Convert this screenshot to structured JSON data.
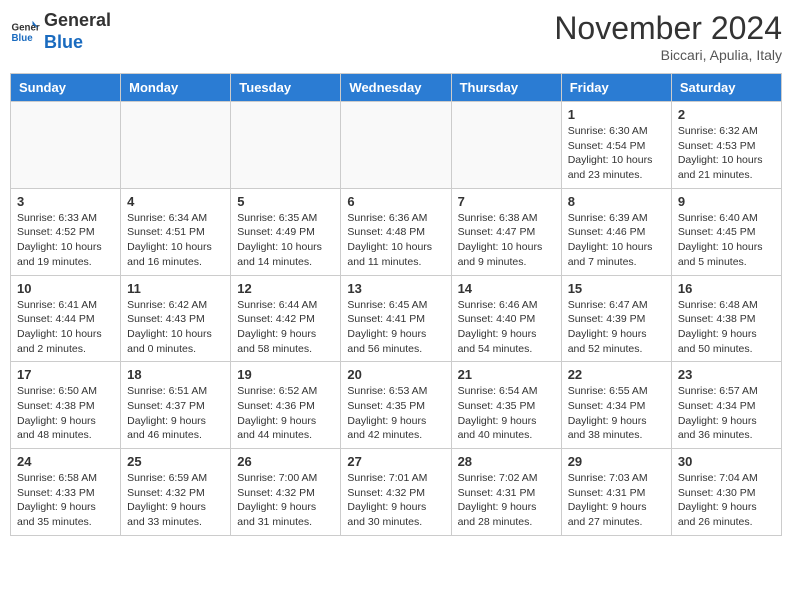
{
  "header": {
    "logo_general": "General",
    "logo_blue": "Blue",
    "title": "November 2024",
    "location": "Biccari, Apulia, Italy"
  },
  "days_of_week": [
    "Sunday",
    "Monday",
    "Tuesday",
    "Wednesday",
    "Thursday",
    "Friday",
    "Saturday"
  ],
  "weeks": [
    {
      "days": [
        {
          "num": "",
          "info": "",
          "empty": true
        },
        {
          "num": "",
          "info": "",
          "empty": true
        },
        {
          "num": "",
          "info": "",
          "empty": true
        },
        {
          "num": "",
          "info": "",
          "empty": true
        },
        {
          "num": "",
          "info": "",
          "empty": true
        },
        {
          "num": "1",
          "info": "Sunrise: 6:30 AM\nSunset: 4:54 PM\nDaylight: 10 hours and 23 minutes.",
          "empty": false
        },
        {
          "num": "2",
          "info": "Sunrise: 6:32 AM\nSunset: 4:53 PM\nDaylight: 10 hours and 21 minutes.",
          "empty": false
        }
      ]
    },
    {
      "days": [
        {
          "num": "3",
          "info": "Sunrise: 6:33 AM\nSunset: 4:52 PM\nDaylight: 10 hours and 19 minutes.",
          "empty": false
        },
        {
          "num": "4",
          "info": "Sunrise: 6:34 AM\nSunset: 4:51 PM\nDaylight: 10 hours and 16 minutes.",
          "empty": false
        },
        {
          "num": "5",
          "info": "Sunrise: 6:35 AM\nSunset: 4:49 PM\nDaylight: 10 hours and 14 minutes.",
          "empty": false
        },
        {
          "num": "6",
          "info": "Sunrise: 6:36 AM\nSunset: 4:48 PM\nDaylight: 10 hours and 11 minutes.",
          "empty": false
        },
        {
          "num": "7",
          "info": "Sunrise: 6:38 AM\nSunset: 4:47 PM\nDaylight: 10 hours and 9 minutes.",
          "empty": false
        },
        {
          "num": "8",
          "info": "Sunrise: 6:39 AM\nSunset: 4:46 PM\nDaylight: 10 hours and 7 minutes.",
          "empty": false
        },
        {
          "num": "9",
          "info": "Sunrise: 6:40 AM\nSunset: 4:45 PM\nDaylight: 10 hours and 5 minutes.",
          "empty": false
        }
      ]
    },
    {
      "days": [
        {
          "num": "10",
          "info": "Sunrise: 6:41 AM\nSunset: 4:44 PM\nDaylight: 10 hours and 2 minutes.",
          "empty": false
        },
        {
          "num": "11",
          "info": "Sunrise: 6:42 AM\nSunset: 4:43 PM\nDaylight: 10 hours and 0 minutes.",
          "empty": false
        },
        {
          "num": "12",
          "info": "Sunrise: 6:44 AM\nSunset: 4:42 PM\nDaylight: 9 hours and 58 minutes.",
          "empty": false
        },
        {
          "num": "13",
          "info": "Sunrise: 6:45 AM\nSunset: 4:41 PM\nDaylight: 9 hours and 56 minutes.",
          "empty": false
        },
        {
          "num": "14",
          "info": "Sunrise: 6:46 AM\nSunset: 4:40 PM\nDaylight: 9 hours and 54 minutes.",
          "empty": false
        },
        {
          "num": "15",
          "info": "Sunrise: 6:47 AM\nSunset: 4:39 PM\nDaylight: 9 hours and 52 minutes.",
          "empty": false
        },
        {
          "num": "16",
          "info": "Sunrise: 6:48 AM\nSunset: 4:38 PM\nDaylight: 9 hours and 50 minutes.",
          "empty": false
        }
      ]
    },
    {
      "days": [
        {
          "num": "17",
          "info": "Sunrise: 6:50 AM\nSunset: 4:38 PM\nDaylight: 9 hours and 48 minutes.",
          "empty": false
        },
        {
          "num": "18",
          "info": "Sunrise: 6:51 AM\nSunset: 4:37 PM\nDaylight: 9 hours and 46 minutes.",
          "empty": false
        },
        {
          "num": "19",
          "info": "Sunrise: 6:52 AM\nSunset: 4:36 PM\nDaylight: 9 hours and 44 minutes.",
          "empty": false
        },
        {
          "num": "20",
          "info": "Sunrise: 6:53 AM\nSunset: 4:35 PM\nDaylight: 9 hours and 42 minutes.",
          "empty": false
        },
        {
          "num": "21",
          "info": "Sunrise: 6:54 AM\nSunset: 4:35 PM\nDaylight: 9 hours and 40 minutes.",
          "empty": false
        },
        {
          "num": "22",
          "info": "Sunrise: 6:55 AM\nSunset: 4:34 PM\nDaylight: 9 hours and 38 minutes.",
          "empty": false
        },
        {
          "num": "23",
          "info": "Sunrise: 6:57 AM\nSunset: 4:34 PM\nDaylight: 9 hours and 36 minutes.",
          "empty": false
        }
      ]
    },
    {
      "days": [
        {
          "num": "24",
          "info": "Sunrise: 6:58 AM\nSunset: 4:33 PM\nDaylight: 9 hours and 35 minutes.",
          "empty": false
        },
        {
          "num": "25",
          "info": "Sunrise: 6:59 AM\nSunset: 4:32 PM\nDaylight: 9 hours and 33 minutes.",
          "empty": false
        },
        {
          "num": "26",
          "info": "Sunrise: 7:00 AM\nSunset: 4:32 PM\nDaylight: 9 hours and 31 minutes.",
          "empty": false
        },
        {
          "num": "27",
          "info": "Sunrise: 7:01 AM\nSunset: 4:32 PM\nDaylight: 9 hours and 30 minutes.",
          "empty": false
        },
        {
          "num": "28",
          "info": "Sunrise: 7:02 AM\nSunset: 4:31 PM\nDaylight: 9 hours and 28 minutes.",
          "empty": false
        },
        {
          "num": "29",
          "info": "Sunrise: 7:03 AM\nSunset: 4:31 PM\nDaylight: 9 hours and 27 minutes.",
          "empty": false
        },
        {
          "num": "30",
          "info": "Sunrise: 7:04 AM\nSunset: 4:30 PM\nDaylight: 9 hours and 26 minutes.",
          "empty": false
        }
      ]
    }
  ]
}
